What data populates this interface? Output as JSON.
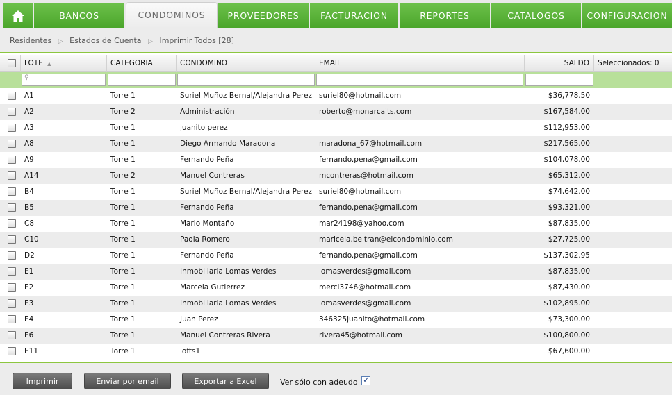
{
  "nav": {
    "tabs": [
      {
        "label": "BANCOS"
      },
      {
        "label": "CONDOMINOS",
        "active": true
      },
      {
        "label": "PROVEEDORES"
      },
      {
        "label": "FACTURACION"
      },
      {
        "label": "REPORTES"
      },
      {
        "label": "CATALOGOS"
      },
      {
        "label": "CONFIGURACION"
      }
    ],
    "home_icon": "home-icon"
  },
  "breadcrumb": [
    "Residentes",
    "Estados de Cuenta",
    "Imprimir Todos [28]"
  ],
  "grid": {
    "headers": {
      "lote": "LOTE",
      "categoria": "CATEGORIA",
      "condomino": "CONDOMINO",
      "email": "EMAIL",
      "saldo": "SALDO",
      "seleccionados": "Seleccionados: 0"
    },
    "rows": [
      {
        "lote": "A1",
        "categoria": "Torre 1",
        "condomino": "Suriel Muñoz Bernal/Alejandra Perez",
        "email": "suriel80@hotmail.com",
        "saldo": "$36,778.50"
      },
      {
        "lote": "A2",
        "categoria": "Torre 2",
        "condomino": "Administración",
        "email": "roberto@monarcaits.com",
        "saldo": "$167,584.00"
      },
      {
        "lote": "A3",
        "categoria": "Torre 1",
        "condomino": "juanito perez",
        "email": "",
        "saldo": "$112,953.00"
      },
      {
        "lote": "A8",
        "categoria": "Torre 1",
        "condomino": "Diego Armando Maradona",
        "email": "maradona_67@hotmail.com",
        "saldo": "$217,565.00"
      },
      {
        "lote": "A9",
        "categoria": "Torre 1",
        "condomino": "Fernando Peña",
        "email": "fernando.pena@gmail.com",
        "saldo": "$104,078.00"
      },
      {
        "lote": "A14",
        "categoria": "Torre 2",
        "condomino": "Manuel Contreras",
        "email": "mcontreras@hotmail.com",
        "saldo": "$65,312.00"
      },
      {
        "lote": "B4",
        "categoria": "Torre 1",
        "condomino": "Suriel Muñoz Bernal/Alejandra Perez",
        "email": "suriel80@hotmail.com",
        "saldo": "$74,642.00"
      },
      {
        "lote": "B5",
        "categoria": "Torre 1",
        "condomino": "Fernando Peña",
        "email": "fernando.pena@gmail.com",
        "saldo": "$93,321.00"
      },
      {
        "lote": "C8",
        "categoria": "Torre 1",
        "condomino": "Mario Montaño",
        "email": "mar24198@yahoo.com",
        "saldo": "$87,835.00"
      },
      {
        "lote": "C10",
        "categoria": "Torre 1",
        "condomino": "Paola Romero",
        "email": "maricela.beltran@elcondominio.com",
        "saldo": "$27,725.00"
      },
      {
        "lote": "D2",
        "categoria": "Torre 1",
        "condomino": "Fernando Peña",
        "email": "fernando.pena@gmail.com",
        "saldo": "$137,302.95"
      },
      {
        "lote": "E1",
        "categoria": "Torre 1",
        "condomino": "Inmobiliaria Lomas Verdes",
        "email": "lomasverdes@gmail.com",
        "saldo": "$87,835.00"
      },
      {
        "lote": "E2",
        "categoria": "Torre 1",
        "condomino": "Marcela Gutierrez",
        "email": "mercl3746@hotmail.com",
        "saldo": "$87,430.00"
      },
      {
        "lote": "E3",
        "categoria": "Torre 1",
        "condomino": "Inmobiliaria Lomas Verdes",
        "email": "lomasverdes@gmail.com",
        "saldo": "$102,895.00"
      },
      {
        "lote": "E4",
        "categoria": "Torre 1",
        "condomino": "Juan Perez",
        "email": "346325juanito@hotmail.com",
        "saldo": "$73,300.00"
      },
      {
        "lote": "E6",
        "categoria": "Torre 1",
        "condomino": "Manuel Contreras Rivera",
        "email": "rivera45@hotmail.com",
        "saldo": "$100,800.00"
      },
      {
        "lote": "E11",
        "categoria": "Torre 1",
        "condomino": "lofts1",
        "email": "",
        "saldo": "$67,600.00"
      }
    ]
  },
  "footer": {
    "imprimir": "Imprimir",
    "enviar": "Enviar por email",
    "exportar": "Exportar a Excel",
    "ver_adeudo": "Ver sólo con adeudo",
    "ver_adeudo_checked": true
  },
  "colors": {
    "accent_green": "#5cb53a",
    "light_green": "#b8e09a",
    "button_dark": "#5a5a5a"
  }
}
